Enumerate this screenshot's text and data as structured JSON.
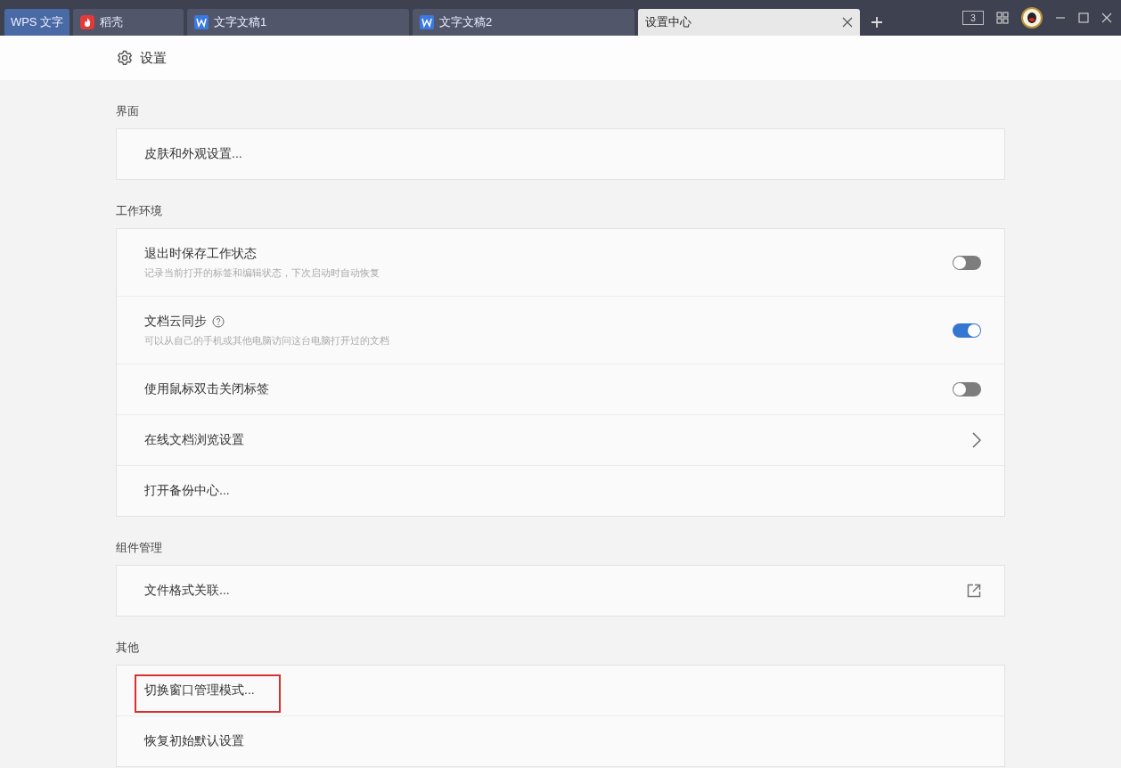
{
  "tabs": [
    {
      "label": "WPS 文字",
      "kind": "home",
      "selected": false
    },
    {
      "label": "稻壳",
      "kind": "docer",
      "selected": false
    },
    {
      "label": "文字文稿1",
      "kind": "doc",
      "selected": false
    },
    {
      "label": "文字文稿2",
      "kind": "doc",
      "selected": false
    },
    {
      "label": "设置中心",
      "kind": "plain",
      "selected": true
    }
  ],
  "window_controls": {
    "badge": "3"
  },
  "header": {
    "title": "设置"
  },
  "sections": [
    {
      "title": "界面",
      "rows": [
        {
          "label": "皮肤和外观设置...",
          "kind": "plain"
        }
      ]
    },
    {
      "title": "工作环境",
      "rows": [
        {
          "label": "退出时保存工作状态",
          "description": "记录当前打开的标签和编辑状态，下次启动时自动恢复",
          "kind": "toggle",
          "on": false
        },
        {
          "label": "文档云同步",
          "help": true,
          "description": "可以从自己的手机或其他电脑访问这台电脑打开过的文档",
          "kind": "toggle",
          "on": true
        },
        {
          "label": "使用鼠标双击关闭标签",
          "kind": "toggle",
          "on": false
        },
        {
          "label": "在线文档浏览设置",
          "kind": "chevron"
        },
        {
          "label": "打开备份中心...",
          "kind": "plain"
        }
      ]
    },
    {
      "title": "组件管理",
      "rows": [
        {
          "label": "文件格式关联...",
          "kind": "external"
        }
      ]
    },
    {
      "title": "其他",
      "rows": [
        {
          "label": "切换窗口管理模式...",
          "kind": "plain",
          "highlighted": true
        },
        {
          "label": "恢复初始默认设置",
          "kind": "plain"
        }
      ]
    }
  ]
}
